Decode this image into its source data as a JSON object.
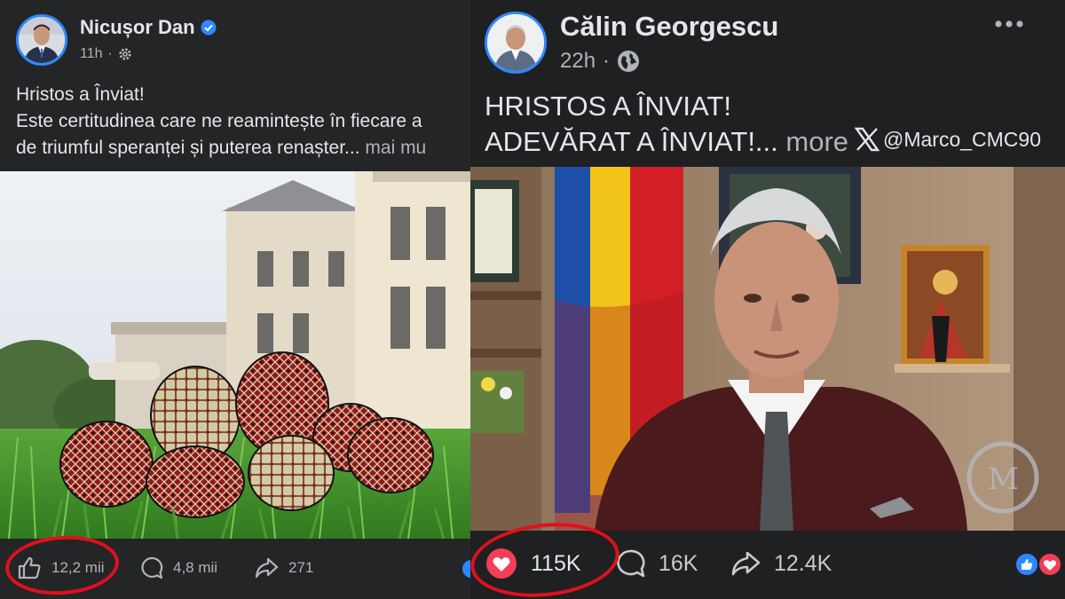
{
  "left_post": {
    "author": "Nicușor Dan",
    "time": "11h",
    "text_line1": "Hristos a Înviat!",
    "text_line2": "Este certitudinea care ne reamintește în fiecare a",
    "text_line3": "de triumful speranței și puterea renașter...",
    "more_label": "mai mu",
    "likes": "12,2 mii",
    "comments": "4,8 mii",
    "shares": "271"
  },
  "right_post": {
    "author": "Călin Georgescu",
    "time": "22h",
    "text_line1": "HRISTOS A ÎNVIAT!",
    "text_line2": "ADEVĂRAT A ÎNVIAT!...",
    "more_label": "more",
    "watermark_handle": "@Marco_CMC90",
    "reactions": "115K",
    "comments": "16K",
    "shares": "12.4K"
  },
  "colors": {
    "accent_blue": "#2d88ff",
    "heart_red": "#f33e58",
    "annotation_red": "#e0101d",
    "flag_blue": "#1e4fa8",
    "flag_yellow": "#f2c318",
    "flag_red": "#d21f26"
  },
  "icons": {
    "verified": "verified-badge-icon",
    "settings": "gear-icon",
    "public": "globe-icon",
    "like": "thumbs-up-icon",
    "comment": "comment-icon",
    "share": "share-icon",
    "menu": "more-dots-icon",
    "x_logo": "x-logo-icon",
    "heart": "heart-icon"
  }
}
